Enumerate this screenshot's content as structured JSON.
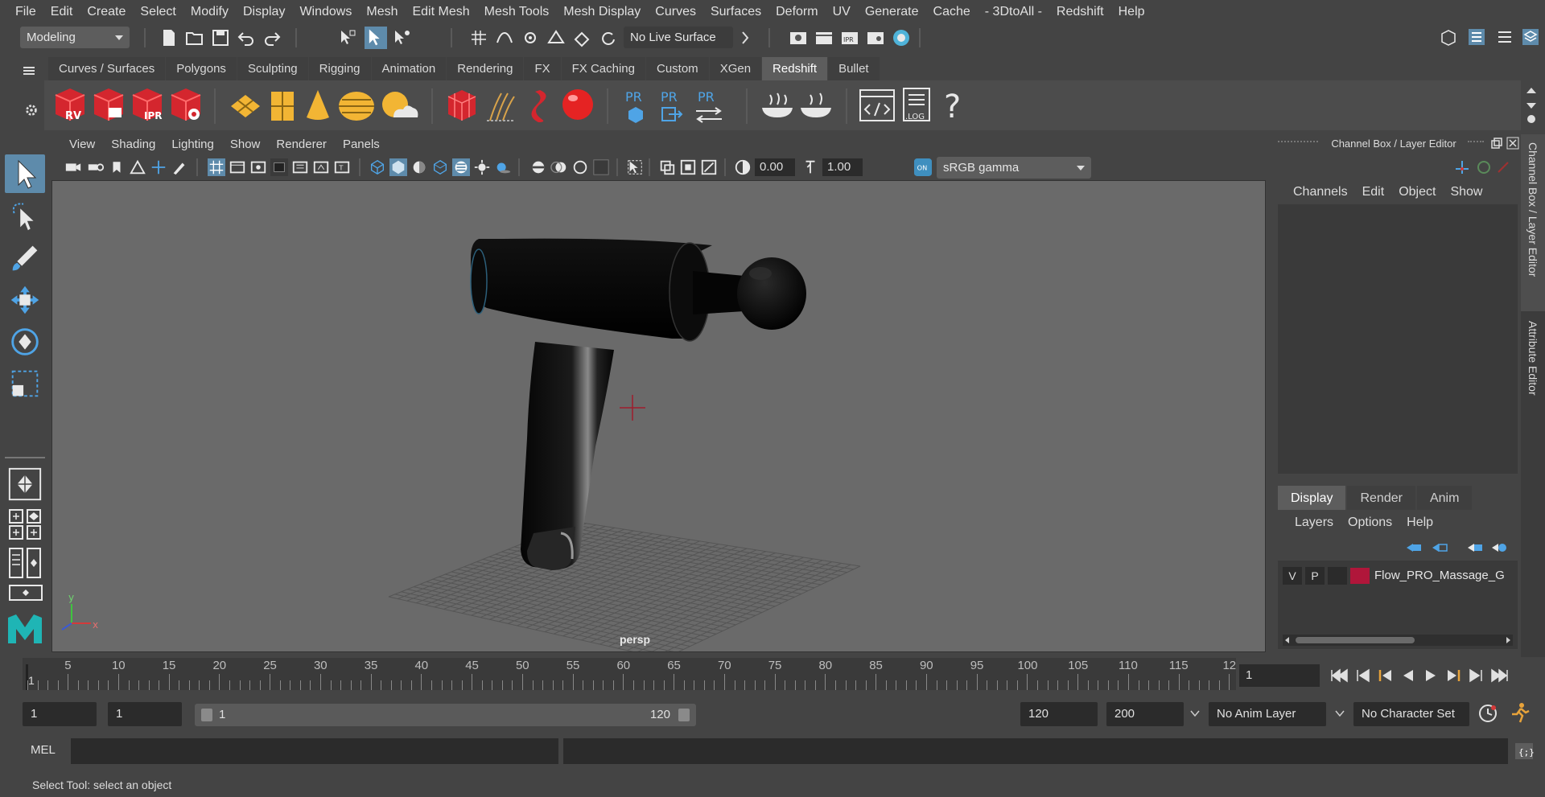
{
  "menus": [
    "File",
    "Edit",
    "Create",
    "Select",
    "Modify",
    "Display",
    "Windows",
    "Mesh",
    "Edit Mesh",
    "Mesh Tools",
    "Mesh Display",
    "Curves",
    "Surfaces",
    "Deform",
    "UV",
    "Generate",
    "Cache",
    "- 3DtoAll -",
    "Redshift",
    "Help"
  ],
  "status": {
    "mode": "Modeling",
    "live_surface": "No Live Surface"
  },
  "shelf": {
    "tabs": [
      "Curves / Surfaces",
      "Polygons",
      "Sculpting",
      "Rigging",
      "Animation",
      "Rendering",
      "FX",
      "FX Caching",
      "Custom",
      "XGen",
      "Redshift",
      "Bullet"
    ],
    "active_tab": "Redshift",
    "icon_labels": {
      "rv": "RV",
      "ipr": "IPR",
      "pr1": "PR",
      "pr2": "PR",
      "pr3": "PR",
      "log": ".LOG",
      "help": "?"
    }
  },
  "viewport": {
    "menus": [
      "View",
      "Shading",
      "Lighting",
      "Show",
      "Renderer",
      "Panels"
    ],
    "exposure": "0.00",
    "gamma": "1.00",
    "color_space": "sRGB gamma",
    "camera_label": "persp",
    "axis_x": "x",
    "axis_y": "y"
  },
  "channel_box": {
    "title": "Channel Box / Layer Editor",
    "menus": [
      "Channels",
      "Edit",
      "Object",
      "Show"
    ],
    "side_tabs": [
      "Channel Box / Layer Editor",
      "Attribute Editor"
    ]
  },
  "layer_editor": {
    "tabs": [
      "Display",
      "Render",
      "Anim"
    ],
    "active_tab": "Display",
    "menus": [
      "Layers",
      "Options",
      "Help"
    ],
    "layers": [
      {
        "v": "V",
        "p": "P",
        "color": "#b0163a",
        "name": "Flow_PRO_Massage_G"
      }
    ]
  },
  "timeline": {
    "labels": [
      "5",
      "10",
      "15",
      "20",
      "25",
      "30",
      "35",
      "40",
      "45",
      "50",
      "55",
      "60",
      "65",
      "70",
      "75",
      "80",
      "85",
      "90",
      "95",
      "100",
      "105",
      "110",
      "115",
      "12"
    ],
    "current_frame_marker": "1",
    "current_frame": "1"
  },
  "range": {
    "start": "1",
    "anim_start": "1",
    "range_left": "1",
    "range_right": "120",
    "end": "120",
    "anim_end": "200",
    "anim_layer": "No Anim Layer",
    "char_set": "No Character Set"
  },
  "command": {
    "label": "MEL"
  },
  "help_line": "Select Tool: select an object"
}
